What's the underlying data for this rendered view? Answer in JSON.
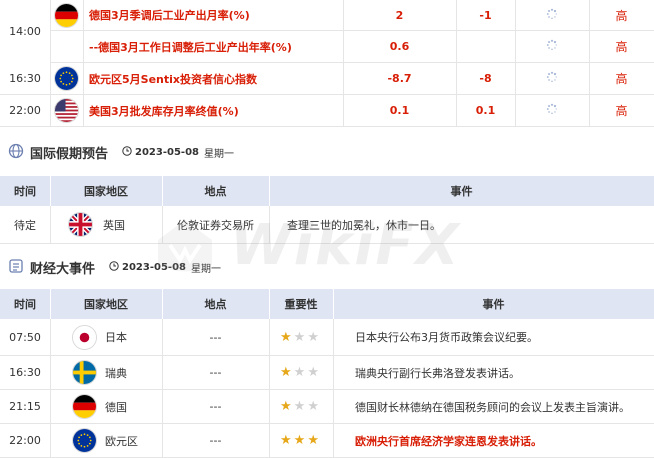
{
  "colors": {
    "accent_red": "#d81e06",
    "header_bg": "#dfe5f3",
    "star": "#e6a81a",
    "star_off": "#d0d0d0"
  },
  "events_top": [
    {
      "time": "",
      "flag": "germany-flag-icon",
      "name": "德国3月季调后工业产出月率(%)",
      "actual": "2",
      "forecast": "-1",
      "previous": "",
      "importance": "高",
      "red": true
    },
    {
      "time": "14:00",
      "flag": "",
      "name": "--德国3月工作日调整后工业产出年率(%)",
      "actual": "0.6",
      "forecast": "",
      "previous": "",
      "importance": "高",
      "red": true
    },
    {
      "time": "16:30",
      "flag": "eu-flag-icon",
      "name": "欧元区5月Sentix投资者信心指数",
      "actual": "-8.7",
      "forecast": "-8",
      "previous": "",
      "importance": "高",
      "red": true
    },
    {
      "time": "22:00",
      "flag": "us-flag-icon",
      "name": "美国3月批发库存月率终值(%)",
      "actual": "0.1",
      "forecast": "0.1",
      "previous": "",
      "importance": "高",
      "red": true
    }
  ],
  "holiday_section": {
    "title": "国际假期预告",
    "date": "2023-05-08",
    "weekday": "星期一",
    "headers": [
      "时间",
      "国家地区",
      "地点",
      "事件"
    ],
    "rows": [
      {
        "time": "待定",
        "flag": "uk-flag-icon",
        "country": "英国",
        "place": "伦敦证券交易所",
        "event": "查理三世的加冕礼，休市一日。"
      }
    ]
  },
  "finance_section": {
    "title": "财经大事件",
    "date": "2023-05-08",
    "weekday": "星期一",
    "headers": [
      "时间",
      "国家地区",
      "地点",
      "重要性",
      "事件"
    ],
    "rows": [
      {
        "time": "07:50",
        "flag": "japan-flag-icon",
        "country": "日本",
        "place": "---",
        "stars": 1,
        "event": "日本央行公布3月货币政策会议纪要。",
        "red": false
      },
      {
        "time": "16:30",
        "flag": "sweden-flag-icon",
        "country": "瑞典",
        "place": "---",
        "stars": 1,
        "event": "瑞典央行副行长弗洛登发表讲话。",
        "red": false
      },
      {
        "time": "21:15",
        "flag": "germany-flag-icon",
        "country": "德国",
        "place": "---",
        "stars": 1,
        "event": "德国财长林德纳在德国税务顾问的会议上发表主旨演讲。",
        "red": false
      },
      {
        "time": "22:00",
        "flag": "eu-flag-icon",
        "country": "欧元区",
        "place": "---",
        "stars": 3,
        "event": "欧洲央行首席经济学家连恩发表讲话。",
        "red": true
      }
    ]
  },
  "watermark": "WikiFX"
}
